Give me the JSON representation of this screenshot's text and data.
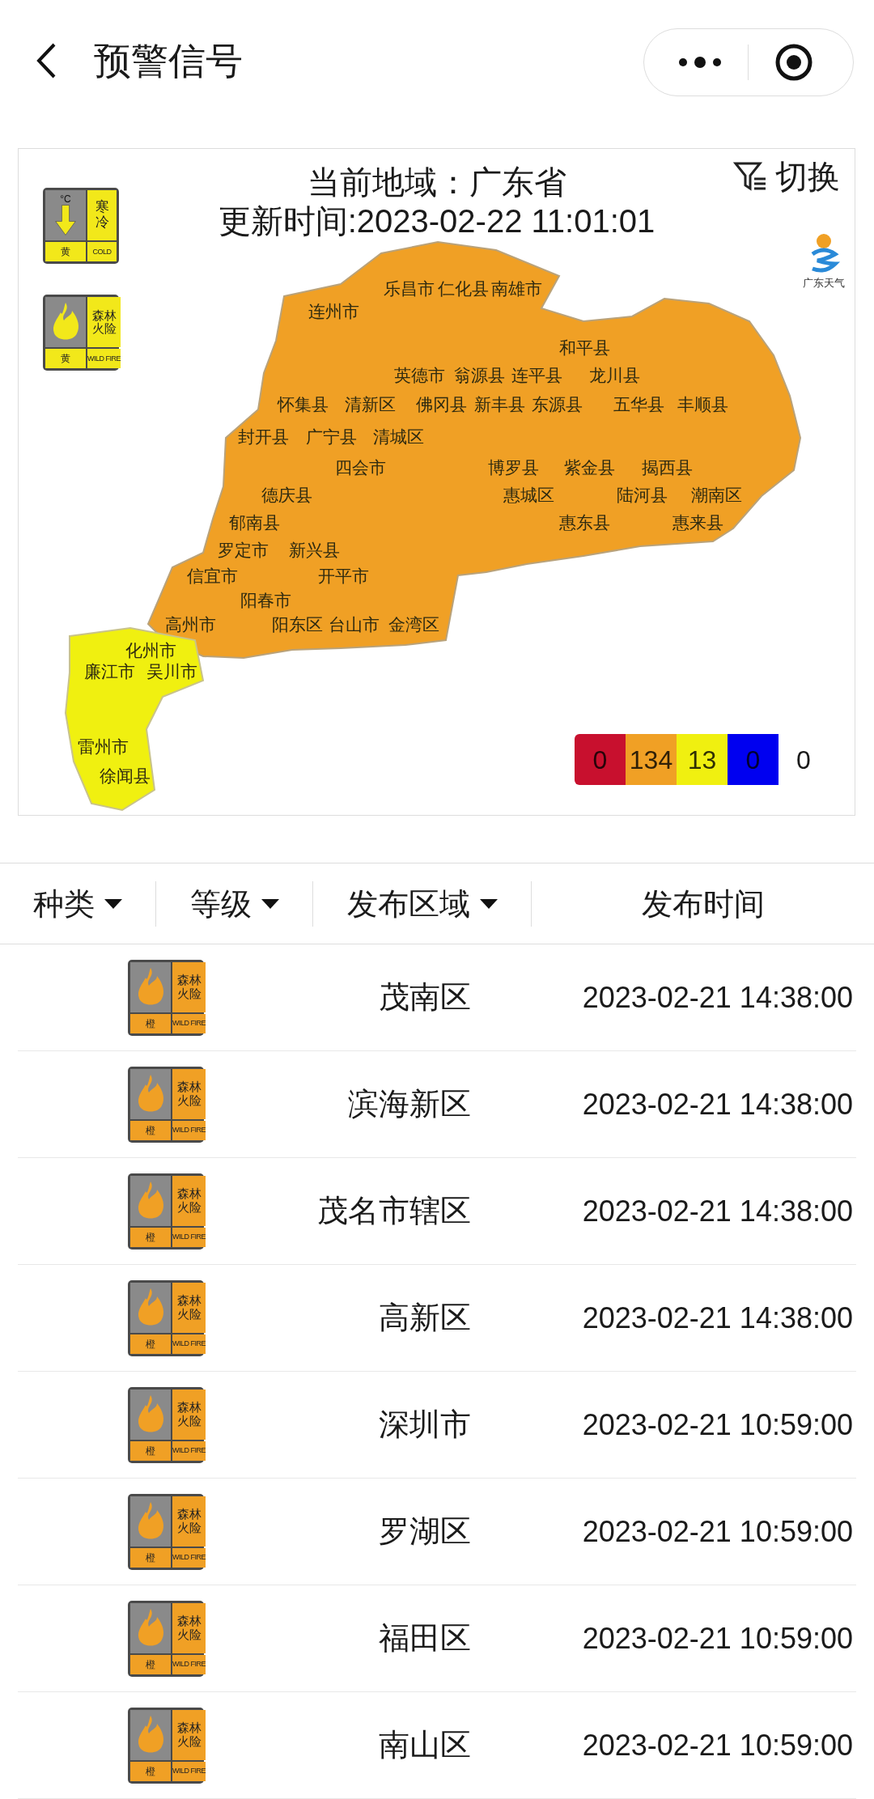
{
  "nav": {
    "title": "预警信号"
  },
  "map_panel": {
    "region_label": "当前地域：广东省",
    "update_time": "更新时间:2023-02-22 11:01:01",
    "switch_button": "切换",
    "logo_text": "广东天气",
    "active_signals": [
      {
        "kind": "cold",
        "unit": "°C",
        "name": "寒冷",
        "level_text": "黄",
        "english": "COLD",
        "color": "#f2e81a"
      },
      {
        "kind": "wildfire",
        "name": "森林火险",
        "level_text": "黄",
        "english": "WILD FIRE",
        "color": "#f2e81a"
      }
    ],
    "map_labels": [
      "乐昌市",
      "仁化县",
      "南雄市",
      "连州市",
      "和平县",
      "英德市",
      "翁源县",
      "连平县",
      "龙川县",
      "怀集县",
      "清新区",
      "佛冈县",
      "新丰县",
      "东源县",
      "五华县",
      "丰顺县",
      "封开县",
      "广宁县",
      "清城区",
      "四会市",
      "博罗县",
      "紫金县",
      "揭西县",
      "德庆县",
      "惠城区",
      "陆河县",
      "潮南区",
      "郁南县",
      "惠东县",
      "惠来县",
      "罗定市",
      "新兴县",
      "信宜市",
      "开平市",
      "阳春市",
      "高州市",
      "阳东区",
      "台山市",
      "金湾区",
      "化州市",
      "廉江市",
      "吴川市",
      "雷州市",
      "徐闻县"
    ],
    "legend": [
      {
        "count": "0",
        "color": "#c8102e"
      },
      {
        "count": "134",
        "color": "#f0a025"
      },
      {
        "count": "13",
        "color": "#f0f010"
      },
      {
        "count": "0",
        "color": "#0000f0"
      },
      {
        "count": "0",
        "color": "#ffffff"
      }
    ]
  },
  "table": {
    "columns": [
      {
        "label": "种类",
        "dropdown": true
      },
      {
        "label": "等级",
        "dropdown": true
      },
      {
        "label": "发布区域",
        "dropdown": true
      },
      {
        "label": "发布时间",
        "dropdown": false
      }
    ],
    "rows": [
      {
        "signal": {
          "kind": "wildfire",
          "name": "森林火险",
          "level_text": "橙",
          "english": "WILD FIRE",
          "color": "#f0a025"
        },
        "area": "茂南区",
        "time": "2023-02-21 14:38:00"
      },
      {
        "signal": {
          "kind": "wildfire",
          "name": "森林火险",
          "level_text": "橙",
          "english": "WILD FIRE",
          "color": "#f0a025"
        },
        "area": "滨海新区",
        "time": "2023-02-21 14:38:00"
      },
      {
        "signal": {
          "kind": "wildfire",
          "name": "森林火险",
          "level_text": "橙",
          "english": "WILD FIRE",
          "color": "#f0a025"
        },
        "area": "茂名市辖区",
        "time": "2023-02-21 14:38:00"
      },
      {
        "signal": {
          "kind": "wildfire",
          "name": "森林火险",
          "level_text": "橙",
          "english": "WILD FIRE",
          "color": "#f0a025"
        },
        "area": "高新区",
        "time": "2023-02-21 14:38:00"
      },
      {
        "signal": {
          "kind": "wildfire",
          "name": "森林火险",
          "level_text": "橙",
          "english": "WILD FIRE",
          "color": "#f0a025"
        },
        "area": "深圳市",
        "time": "2023-02-21 10:59:00"
      },
      {
        "signal": {
          "kind": "wildfire",
          "name": "森林火险",
          "level_text": "橙",
          "english": "WILD FIRE",
          "color": "#f0a025"
        },
        "area": "罗湖区",
        "time": "2023-02-21 10:59:00"
      },
      {
        "signal": {
          "kind": "wildfire",
          "name": "森林火险",
          "level_text": "橙",
          "english": "WILD FIRE",
          "color": "#f0a025"
        },
        "area": "福田区",
        "time": "2023-02-21 10:59:00"
      },
      {
        "signal": {
          "kind": "wildfire",
          "name": "森林火险",
          "level_text": "橙",
          "english": "WILD FIRE",
          "color": "#f0a025"
        },
        "area": "南山区",
        "time": "2023-02-21 10:59:00"
      }
    ]
  }
}
